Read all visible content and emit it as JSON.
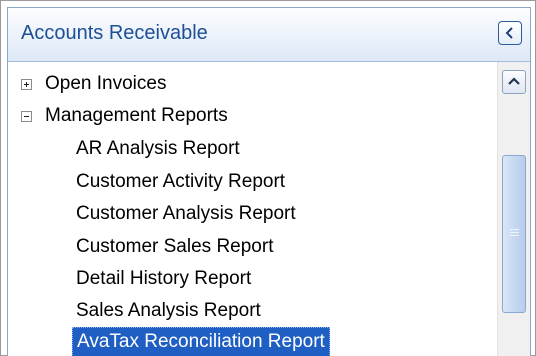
{
  "panel": {
    "title": "Accounts Receivable",
    "collapse_icon": "chevron-left-icon"
  },
  "tree": {
    "nodes": [
      {
        "label": "Open Invoices",
        "expander": "plus",
        "level": 0
      },
      {
        "label": "Management Reports",
        "expander": "minus",
        "level": 0
      },
      {
        "label": "AR Analysis Report",
        "level": 1
      },
      {
        "label": "Customer Activity Report",
        "level": 1
      },
      {
        "label": "Customer Analysis Report",
        "level": 1
      },
      {
        "label": "Customer Sales Report",
        "level": 1
      },
      {
        "label": "Detail History Report",
        "level": 1
      },
      {
        "label": "Sales Analysis Report",
        "level": 1
      },
      {
        "label": "AvaTax Reconciliation Report",
        "level": 1,
        "selected": true
      }
    ]
  },
  "scrollbar": {
    "up_icon": "chevron-up-icon",
    "thumb_grip_icon": "grip-lines-icon"
  },
  "colors": {
    "header_text": "#1e4e96",
    "selection_bg": "#1f5fc4",
    "selection_text": "#ffffff"
  }
}
